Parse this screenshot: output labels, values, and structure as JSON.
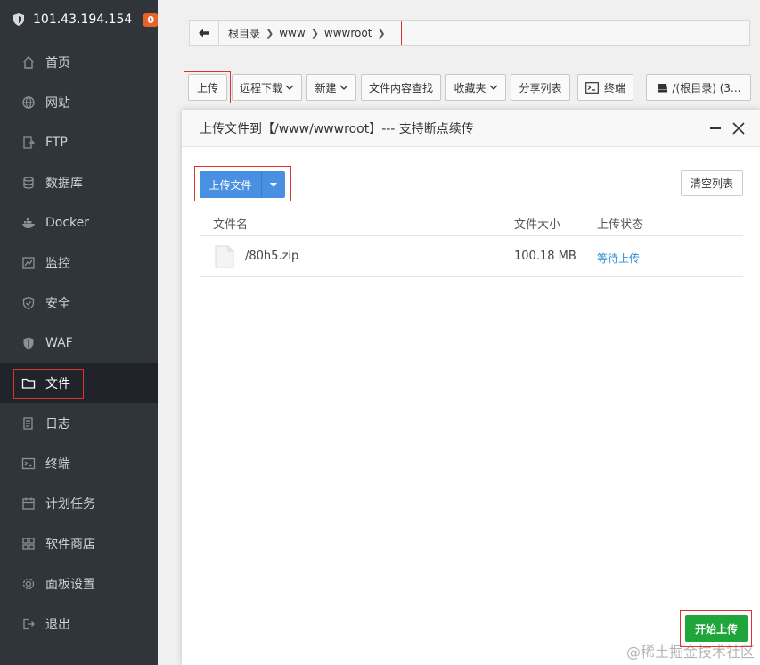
{
  "sidebar": {
    "server_ip": "101.43.194.154",
    "badge": "0",
    "items": [
      {
        "label": "首页",
        "icon": "home-icon"
      },
      {
        "label": "网站",
        "icon": "globe-icon"
      },
      {
        "label": "FTP",
        "icon": "ftp-icon"
      },
      {
        "label": "数据库",
        "icon": "database-icon"
      },
      {
        "label": "Docker",
        "icon": "docker-icon"
      },
      {
        "label": "监控",
        "icon": "monitor-icon"
      },
      {
        "label": "安全",
        "icon": "shield-icon"
      },
      {
        "label": "WAF",
        "icon": "waf-icon"
      },
      {
        "label": "文件",
        "icon": "folder-icon",
        "active": true
      },
      {
        "label": "日志",
        "icon": "log-icon"
      },
      {
        "label": "终端",
        "icon": "terminal-icon"
      },
      {
        "label": "计划任务",
        "icon": "calendar-icon"
      },
      {
        "label": "软件商店",
        "icon": "grid-icon"
      },
      {
        "label": "面板设置",
        "icon": "gear-icon"
      },
      {
        "label": "退出",
        "icon": "logout-icon"
      }
    ]
  },
  "breadcrumb": [
    "根目录",
    "www",
    "wwwroot"
  ],
  "toolbar": {
    "upload": "上传",
    "remote_download": "远程下载",
    "new": "新建",
    "search_content": "文件内容查找",
    "favorites": "收藏夹",
    "share_list": "分享列表",
    "terminal": "终端",
    "disk": "/(根目录) (3..."
  },
  "dialog": {
    "title": "上传文件到【/www/wwwroot】--- 支持断点续传",
    "upload_files": "上传文件",
    "clear_list": "清空列表",
    "columns": {
      "name": "文件名",
      "size": "文件大小",
      "status": "上传状态"
    },
    "files": [
      {
        "name": "/80h5.zip",
        "size": "100.18 MB",
        "status": "等待上传"
      }
    ],
    "start_upload": "开始上传"
  },
  "watermark": "@稀土掘金技术社区",
  "colors": {
    "sidebar_bg": "#30353b",
    "primary_blue": "#4a90e2",
    "start_green": "#20a53a",
    "badge_orange": "#e8632a",
    "highlight_red": "#e0312b"
  }
}
